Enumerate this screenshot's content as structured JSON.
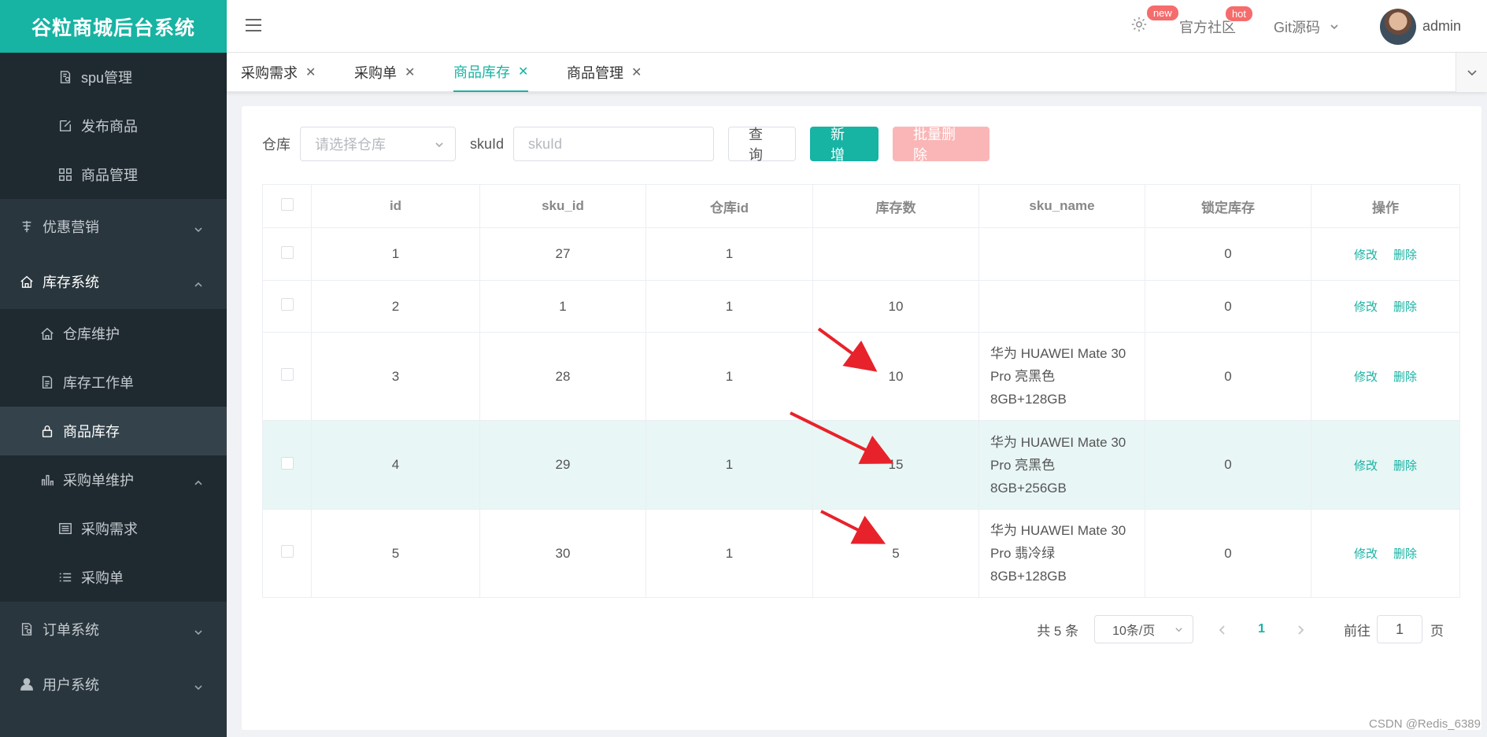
{
  "app": {
    "logo": "谷粒商城后台系统"
  },
  "sidebar": {
    "items": [
      {
        "label": "spu管理",
        "icon": "doc-gear-icon",
        "level": 3
      },
      {
        "label": "发布商品",
        "icon": "edit-icon",
        "level": 3
      },
      {
        "label": "商品管理",
        "icon": "grid-icon",
        "level": 3
      },
      {
        "label": "优惠营销",
        "icon": "discount-icon",
        "level": 1,
        "expanded": false
      },
      {
        "label": "库存系统",
        "icon": "home-icon",
        "level": 1,
        "expanded": true
      },
      {
        "label": "仓库维护",
        "icon": "home-icon",
        "level": 2
      },
      {
        "label": "库存工作单",
        "icon": "document-icon",
        "level": 2
      },
      {
        "label": "商品库存",
        "icon": "lock-icon",
        "level": 2,
        "active": true
      },
      {
        "label": "采购单维护",
        "icon": "bar-chart-icon",
        "level": 2,
        "expanded": true
      },
      {
        "label": "采购需求",
        "icon": "list-box-icon",
        "level": 3
      },
      {
        "label": "采购单",
        "icon": "list-icon",
        "level": 3
      },
      {
        "label": "订单系统",
        "icon": "doc-gear-icon",
        "level": 1,
        "expanded": false
      },
      {
        "label": "用户系统",
        "icon": "user-icon",
        "level": 1,
        "expanded": false
      }
    ]
  },
  "topbar": {
    "badge_new": "new",
    "community": "官方社区",
    "badge_hot": "hot",
    "git": "Git源码",
    "user": "admin"
  },
  "tabs": [
    {
      "label": "采购需求",
      "active": false
    },
    {
      "label": "采购单",
      "active": false
    },
    {
      "label": "商品库存",
      "active": true
    },
    {
      "label": "商品管理",
      "active": false
    }
  ],
  "filters": {
    "warehouse_label": "仓库",
    "warehouse_placeholder": "请选择仓库",
    "skuid_label": "skuId",
    "skuid_placeholder": "skuId",
    "query": "查询",
    "add": "新增",
    "batch_delete": "批量删除"
  },
  "table": {
    "columns": [
      "id",
      "sku_id",
      "仓库id",
      "库存数",
      "sku_name",
      "锁定库存",
      "操作"
    ],
    "rows": [
      {
        "id": "1",
        "sku_id": "27",
        "ware_id": "1",
        "stock": "",
        "sku_name": "",
        "locked": "0"
      },
      {
        "id": "2",
        "sku_id": "1",
        "ware_id": "1",
        "stock": "10",
        "sku_name": "",
        "locked": "0"
      },
      {
        "id": "3",
        "sku_id": "28",
        "ware_id": "1",
        "stock": "10",
        "sku_name": "华为 HUAWEI Mate 30 Pro 亮黑色 8GB+128GB",
        "locked": "0"
      },
      {
        "id": "4",
        "sku_id": "29",
        "ware_id": "1",
        "stock": "15",
        "sku_name": "华为 HUAWEI Mate 30 Pro 亮黑色 8GB+256GB",
        "locked": "0",
        "highlight": true
      },
      {
        "id": "5",
        "sku_id": "30",
        "ware_id": "1",
        "stock": "5",
        "sku_name": "华为 HUAWEI Mate 30 Pro 翡冷绿 8GB+128GB",
        "locked": "0"
      }
    ],
    "edit": "修改",
    "delete": "删除"
  },
  "pagination": {
    "total": "共 5 条",
    "page_size": "10条/页",
    "current": "1",
    "goto_label": "前往",
    "goto_value": "1",
    "page_unit": "页"
  },
  "watermark": "CSDN @Redis_6389",
  "colors": {
    "primary": "#17b3a3",
    "sidebar": "#29363d",
    "annotation": "#e8222a"
  }
}
